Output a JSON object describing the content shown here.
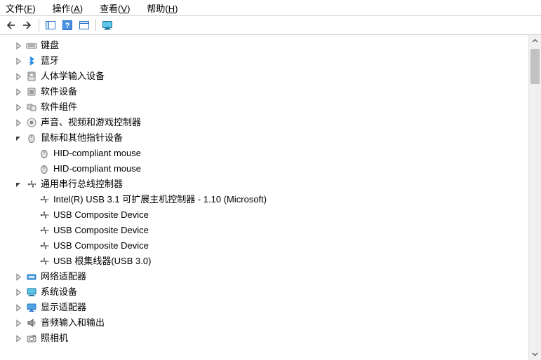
{
  "menu": {
    "file": {
      "label": "文件",
      "accel": "F"
    },
    "action": {
      "label": "操作",
      "accel": "A"
    },
    "view": {
      "label": "查看",
      "accel": "V"
    },
    "help": {
      "label": "帮助",
      "accel": "H"
    }
  },
  "toolbar": {
    "back": "back-arrow-icon",
    "forward": "forward-arrow-icon",
    "show_hide": "show-hide-icon",
    "help": "help-icon",
    "properties": "properties-icon",
    "monitor": "monitor-icon"
  },
  "tree": [
    {
      "id": "keyboard",
      "level": 1,
      "exp": "closed",
      "icon": "keyboard-icon",
      "label": "键盘"
    },
    {
      "id": "bluetooth",
      "level": 1,
      "exp": "closed",
      "icon": "bluetooth-icon",
      "label": "蓝牙"
    },
    {
      "id": "hid",
      "level": 1,
      "exp": "closed",
      "icon": "hid-icon",
      "label": "人体学输入设备"
    },
    {
      "id": "swdev",
      "level": 1,
      "exp": "closed",
      "icon": "swdev-icon",
      "label": "软件设备"
    },
    {
      "id": "swcomp",
      "level": 1,
      "exp": "closed",
      "icon": "swcomp-icon",
      "label": "软件组件"
    },
    {
      "id": "sound",
      "level": 1,
      "exp": "closed",
      "icon": "sound-icon",
      "label": "声音、视频和游戏控制器"
    },
    {
      "id": "mouse",
      "level": 1,
      "exp": "open",
      "icon": "mouse-cat-icon",
      "label": "鼠标和其他指针设备"
    },
    {
      "id": "mouse-hid1",
      "level": 2,
      "exp": "none",
      "icon": "mouse-icon",
      "label": "HID-compliant mouse"
    },
    {
      "id": "mouse-hid2",
      "level": 2,
      "exp": "none",
      "icon": "mouse-icon",
      "label": "HID-compliant mouse"
    },
    {
      "id": "usb",
      "level": 1,
      "exp": "open",
      "icon": "usb-cat-icon",
      "label": "通用串行总线控制器"
    },
    {
      "id": "usb-intel",
      "level": 2,
      "exp": "none",
      "icon": "usb-icon",
      "label": "Intel(R) USB 3.1 可扩展主机控制器 - 1.10 (Microsoft)"
    },
    {
      "id": "usb-comp1",
      "level": 2,
      "exp": "none",
      "icon": "usb-icon",
      "label": "USB Composite Device"
    },
    {
      "id": "usb-comp2",
      "level": 2,
      "exp": "none",
      "icon": "usb-icon",
      "label": "USB Composite Device"
    },
    {
      "id": "usb-comp3",
      "level": 2,
      "exp": "none",
      "icon": "usb-icon",
      "label": "USB Composite Device"
    },
    {
      "id": "usb-roothub",
      "level": 2,
      "exp": "none",
      "icon": "usb-icon",
      "label": "USB 根集线器(USB 3.0)"
    },
    {
      "id": "network",
      "level": 1,
      "exp": "closed",
      "icon": "network-icon",
      "label": "网络适配器"
    },
    {
      "id": "system",
      "level": 1,
      "exp": "closed",
      "icon": "system-icon",
      "label": "系统设备"
    },
    {
      "id": "display",
      "level": 1,
      "exp": "closed",
      "icon": "display-icon",
      "label": "显示适配器"
    },
    {
      "id": "audio",
      "level": 1,
      "exp": "closed",
      "icon": "audio-icon",
      "label": "音频输入和输出"
    },
    {
      "id": "camera",
      "level": 1,
      "exp": "closed",
      "icon": "camera-icon",
      "label": "照相机"
    }
  ]
}
